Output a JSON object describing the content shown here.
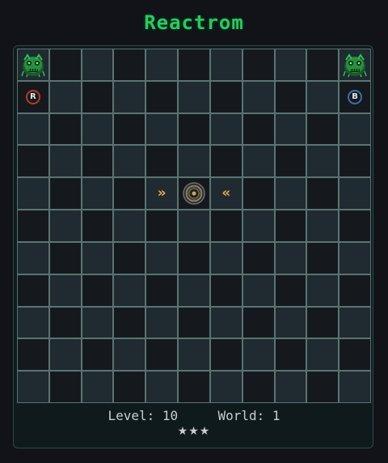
{
  "game": {
    "title": "Reactrom",
    "level_label": "Level:",
    "level": "10",
    "world_label": "World:",
    "world": "1",
    "stars": "★★★",
    "board_size": 11
  },
  "colors": {
    "title": "#1fcf5c",
    "cell_dark": "#15191d",
    "cell_light": "#1f2a31",
    "grid_line": "#5a7471",
    "panel_border": "#2a4b4c",
    "arrow": "#e4a64a",
    "red_badge": "#b43a2a",
    "blue_badge": "#3a6fa8",
    "monster_green": "#2fc04f"
  },
  "board": {
    "monster_left": {
      "row": 0,
      "col": 0,
      "icon": "green-monster-icon"
    },
    "monster_right": {
      "row": 0,
      "col": 10,
      "icon": "green-monster-icon"
    },
    "badge_red": {
      "row": 1,
      "col": 0,
      "letter": "R",
      "icon": "red-badge-icon"
    },
    "badge_blue": {
      "row": 1,
      "col": 10,
      "letter": "B",
      "icon": "blue-badge-icon"
    },
    "arrow_right": {
      "row": 4,
      "col": 4,
      "glyph": "»",
      "icon": "double-arrow-right-icon"
    },
    "reactor": {
      "row": 4,
      "col": 5,
      "icon": "reactor-core-icon"
    },
    "arrow_left": {
      "row": 4,
      "col": 6,
      "glyph": "«",
      "icon": "double-arrow-left-icon"
    }
  }
}
